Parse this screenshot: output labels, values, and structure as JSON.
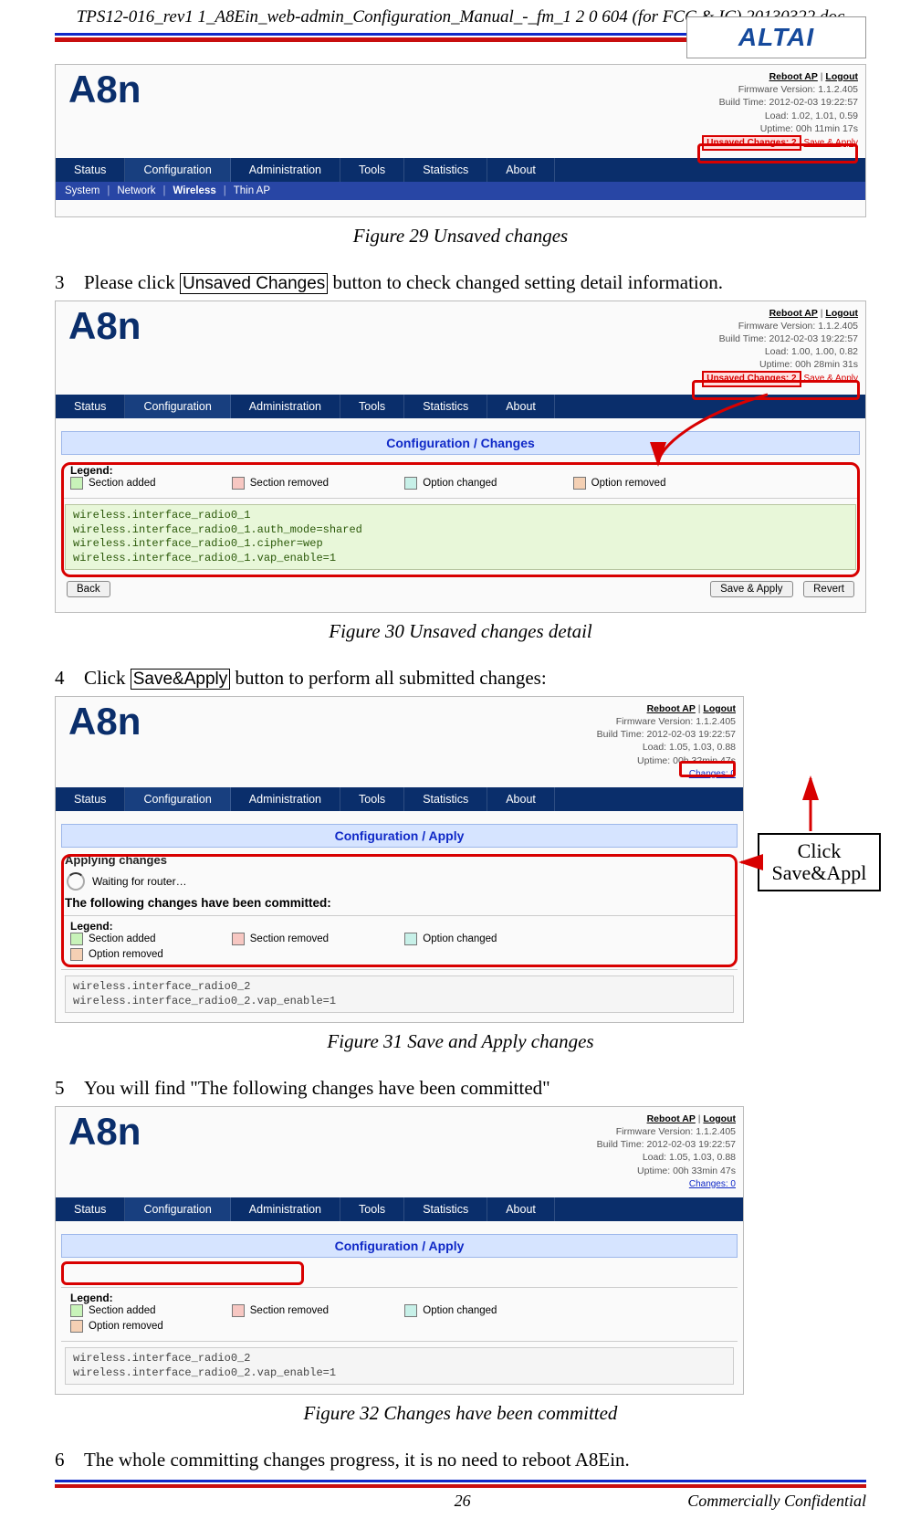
{
  "doc": {
    "header_title": "TPS12-016_rev1 1_A8Ein_web-admin_Configuration_Manual_-_fm_1 2 0 604 (for FCC & IC) 20130322.doc",
    "logo_text": "ALTAI",
    "page_num": "26",
    "confidential": "Commercially Confidential"
  },
  "captions": {
    "fig29": "Figure 29 Unsaved changes",
    "fig30": "Figure 30 Unsaved changes detail",
    "fig31": "Figure 31 Save and Apply changes",
    "fig32": "Figure 32 Changes have been committed"
  },
  "steps": {
    "s3_num": "3",
    "s3_a": "Please click ",
    "s3_btn": "Unsaved Changes",
    "s3_b": " button to check changed setting detail information.",
    "s4_num": "4",
    "s4_a": "Click ",
    "s4_btn": "Save&Apply",
    "s4_b": " button to perform all submitted changes:",
    "s5_num": "5",
    "s5_a": "You will find \"The following changes have been committed\"",
    "s6_num": "6",
    "s6_a": "The whole committing changes progress, it is no need to reboot A8Ein."
  },
  "ui": {
    "product": "A8n",
    "top_links": {
      "reboot": "Reboot AP",
      "sep": "|",
      "logout": "Logout"
    },
    "nav": [
      "Status",
      "Configuration",
      "Administration",
      "Tools",
      "Statistics",
      "About"
    ],
    "subnav": [
      "System",
      "Network",
      "Wireless",
      "Thin AP"
    ],
    "legend": {
      "title": "Legend:",
      "added": "Section added",
      "removed": "Section removed",
      "opt_changed": "Option changed",
      "opt_removed": "Option removed"
    },
    "btns": {
      "back": "Back",
      "save_apply": "Save & Apply",
      "revert": "Revert"
    }
  },
  "status_lines": {
    "fw": "Firmware Version: 1.1.2.405",
    "build": "Build Time: 2012-02-03 19:22:57",
    "ss1": {
      "load": "Load: 1.02, 1.01, 0.59",
      "uptime": "Uptime: 00h 11min 17s",
      "unsaved": "Unsaved Changes: 2",
      "save": "Save & Apply"
    },
    "ss2": {
      "load": "Load: 1.00, 1.00, 0.82",
      "uptime": "Uptime: 00h 28min 31s",
      "unsaved": "Unsaved Changes: 2",
      "save": "Save & Apply"
    },
    "ss3": {
      "load": "Load: 1.05, 1.03, 0.88",
      "uptime": "Uptime: 00h 32min 47s",
      "changes": "Changes: 0"
    },
    "ss4": {
      "load": "Load: 1.05, 1.03, 0.88",
      "uptime": "Uptime: 00h 33min 47s",
      "changes": "Changes: 0"
    }
  },
  "panels": {
    "changes": "Configuration / Changes",
    "apply": "Configuration / Apply"
  },
  "codes": {
    "c1": "wireless.interface_radio0_1\nwireless.interface_radio0_1.auth_mode=shared\nwireless.interface_radio0_1.cipher=wep\nwireless.interface_radio0_1.vap_enable=1",
    "c2": "wireless.interface_radio0_2\nwireless.interface_radio0_2.vap_enable=1",
    "c3": "wireless.interface_radio0_2\nwireless.interface_radio0_2.vap_enable=1"
  },
  "ss3_text": {
    "applying": "Applying changes",
    "waiting": "Waiting for router…",
    "committed": "The following changes have been committed:"
  },
  "ss4_text": {
    "committed_hidden": "The following changes have been committed:"
  },
  "callout": {
    "line1": "Click",
    "line2": "Save&Appl"
  }
}
